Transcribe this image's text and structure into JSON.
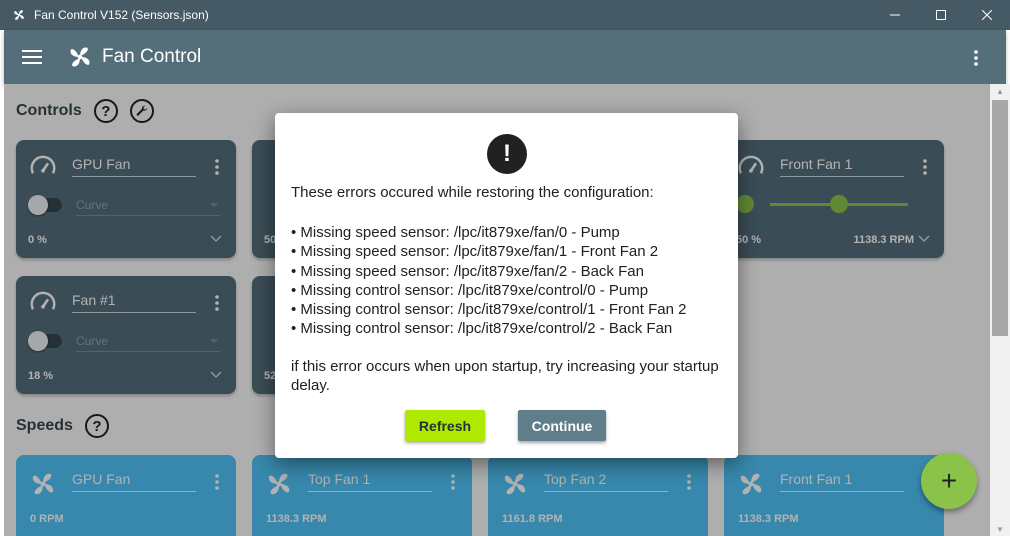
{
  "window": {
    "title": "Fan Control V152 (Sensors.json)"
  },
  "appbar": {
    "title": "Fan Control"
  },
  "sections": {
    "controls": "Controls",
    "speeds": "Speeds",
    "help_glyph": "?"
  },
  "controls": [
    {
      "name": "GPU Fan",
      "mode": "Curve",
      "percent": "0 %"
    },
    {
      "name": "Fan #1",
      "mode": "Curve",
      "percent": "18 %"
    },
    {
      "name": "Front Fan 1",
      "percent": "50 %",
      "rpm": "1138.3 RPM",
      "slider_fraction": 0.5
    }
  ],
  "partial_cards": {
    "row1_percent": "50",
    "row2_percent": "52"
  },
  "speeds": [
    {
      "name": "GPU Fan",
      "rpm": "0 RPM"
    },
    {
      "name": "Top Fan 1",
      "rpm": "1138.3 RPM"
    },
    {
      "name": "Top Fan 2",
      "rpm": "1161.8 RPM"
    },
    {
      "name": "Front Fan 1",
      "rpm": "1138.3 RPM"
    }
  ],
  "dialog": {
    "icon": "!",
    "message": "These errors occured while restoring the configuration:",
    "errors": [
      "• Missing speed sensor: /lpc/it879xe/fan/0 - Pump",
      "• Missing speed sensor: /lpc/it879xe/fan/1 - Front Fan 2",
      "• Missing speed sensor: /lpc/it879xe/fan/2 - Back Fan",
      "• Missing control sensor: /lpc/it879xe/control/0 - Pump",
      "• Missing control sensor: /lpc/it879xe/control/1 - Front Fan 2",
      "• Missing control sensor: /lpc/it879xe/control/2 - Back Fan"
    ],
    "hint": "if this error occurs when upon startup, try increasing your startup delay.",
    "refresh_label": "Refresh",
    "continue_label": "Continue"
  },
  "fab": {
    "label": "+"
  },
  "colors": {
    "primary": "#546e7a",
    "accent": "#8bc34a",
    "speed_card": "#4fc3f7",
    "refresh": "#aeea00",
    "continue": "#607d8b"
  }
}
